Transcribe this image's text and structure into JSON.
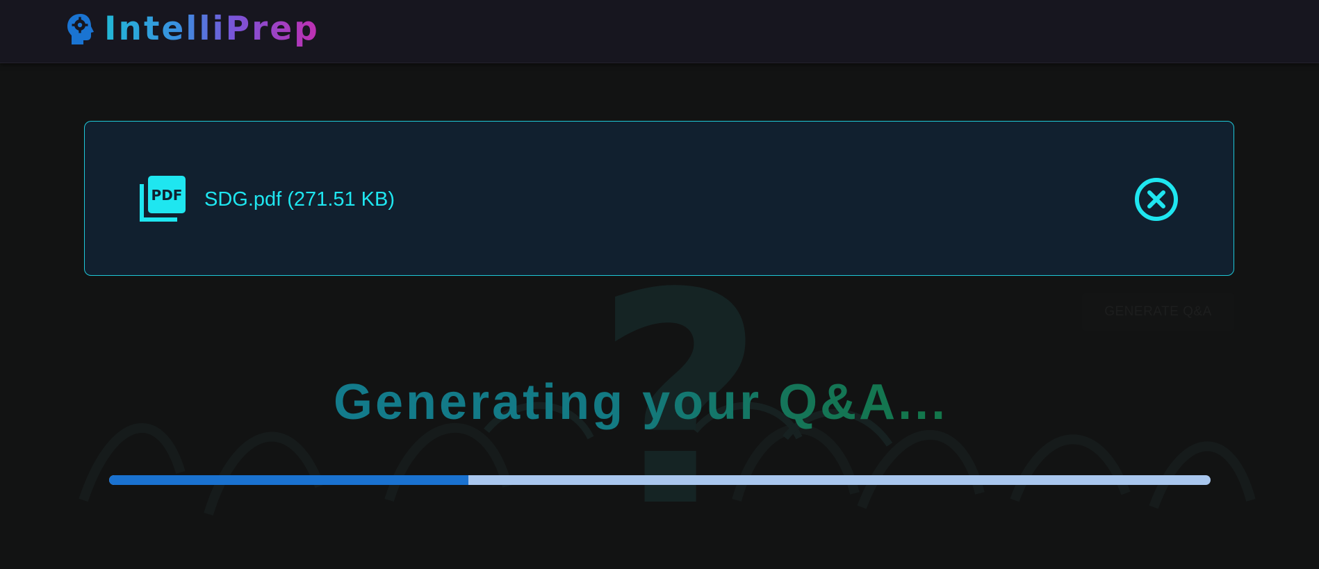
{
  "header": {
    "brand_name": "IntelliPrep",
    "brand_icon": "head-gear-icon"
  },
  "file": {
    "icon": "pdf-icon",
    "name_label": "SDG.pdf (271.51 KB)",
    "remove_icon": "close-circle-icon"
  },
  "actions": {
    "generate_label": "GENERATE Q&A"
  },
  "status": {
    "message": "Generating your Q&A...",
    "progress_fraction": 0.326
  },
  "colors": {
    "accent_cyan": "#1fe6f0",
    "progress_fill": "#1a72d0",
    "progress_track": "#a9c7ee",
    "brand_gradient_start": "#22b8d6",
    "brand_gradient_end": "#c02fb0"
  }
}
